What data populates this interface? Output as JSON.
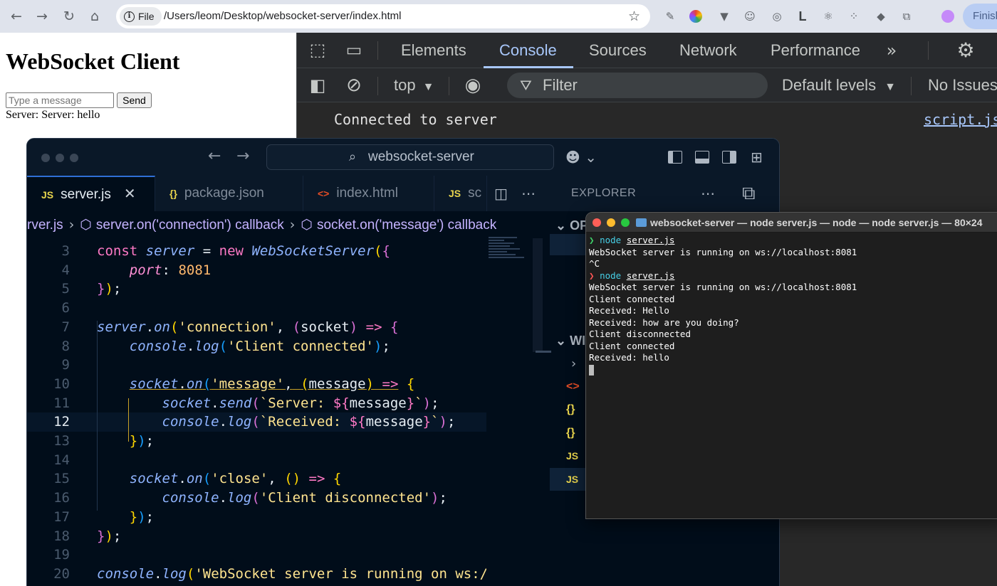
{
  "browser": {
    "file_chip": "File",
    "url": "/Users/leom/Desktop/websocket-server/index.html",
    "finish_label": "Finish"
  },
  "page": {
    "title": "WebSocket Client",
    "input_placeholder": "Type a message",
    "send_label": "Send",
    "server_message": "Server: Server: hello"
  },
  "devtools": {
    "tabs": [
      "Elements",
      "Console",
      "Sources",
      "Network",
      "Performance"
    ],
    "active_tab": "Console",
    "context": "top",
    "filter_placeholder": "Filter",
    "levels": "Default levels",
    "issues": "No Issues",
    "console_message": "Connected to server",
    "console_source": "script.js"
  },
  "vscode": {
    "command_center": "websocket-server",
    "tabs": [
      {
        "icon": "JS",
        "label": "server.js",
        "active": true,
        "icon_color": "#e8d44d"
      },
      {
        "icon": "{}",
        "label": "package.json",
        "active": false,
        "icon_color": "#e8d44d"
      },
      {
        "icon": "<>",
        "label": "index.html",
        "active": false,
        "icon_color": "#e44d26"
      },
      {
        "icon": "JS",
        "label": "sc",
        "active": false,
        "icon_color": "#e8d44d"
      }
    ],
    "breadcrumb": [
      "rver.js",
      "server.on('connection') callback",
      "socket.on('message') callback"
    ],
    "explorer_label": "EXPLORER",
    "explorer_sections": [
      "OP",
      "WI"
    ],
    "current_line": 12,
    "code_lines": [
      {
        "n": 3,
        "html": "<span style='color:#ff79c6'>const</span> <span style='color:#8fb4ff;font-style:italic'>server</span> <span style='color:#e6edf3'>=</span> <span style='color:#ff79c6'>new</span> <span style='color:#8fb4ff;font-style:italic'>WebSocketServer</span><span style='color:#ffd700'>(</span><span style='color:#da70d6'>{</span>"
      },
      {
        "n": 4,
        "html": "    <span style='color:#ff8fd6;font-style:italic'>port</span><span style='color:#e6edf3'>:</span> <span style='color:#ffb86c'>8081</span>"
      },
      {
        "n": 5,
        "html": "<span style='color:#da70d6'>}</span><span style='color:#ffd700'>)</span><span style='color:#e6edf3'>;</span>"
      },
      {
        "n": 6,
        "html": ""
      },
      {
        "n": 7,
        "html": "<span style='color:#8fb4ff;font-style:italic'>server</span><span style='color:#e6edf3'>.</span><span style='color:#8fb4ff;font-style:italic'>on</span><span style='color:#ffd700'>(</span><span style='color:#ffe48f'>'connection'</span><span style='color:#e6edf3'>,</span> <span style='color:#da70d6'>(</span><span style='color:#e6edf3'>socket</span><span style='color:#da70d6'>)</span> <span style='color:#ff79c6'>=&gt;</span> <span style='color:#da70d6'>{</span>"
      },
      {
        "n": 8,
        "html": "    <span style='color:#8fb4ff;font-style:italic'>console</span><span style='color:#e6edf3'>.</span><span style='color:#8fb4ff;font-style:italic'>log</span><span style='color:#179fff'>(</span><span style='color:#ffe48f'>'Client connected'</span><span style='color:#179fff'>)</span><span style='color:#e6edf3'>;</span>"
      },
      {
        "n": 9,
        "html": ""
      },
      {
        "n": 10,
        "html": "    <span style='color:#8fb4ff;font-style:italic;text-decoration:underline;text-decoration-color:#c9a227'>socket</span><span style='color:#e6edf3;text-decoration:underline;text-decoration-color:#c9a227'>.</span><span style='color:#8fb4ff;font-style:italic;text-decoration:underline;text-decoration-color:#c9a227'>on</span><span style='color:#179fff;text-decoration:underline;text-decoration-color:#c9a227'>(</span><span style='color:#ffe48f;text-decoration:underline;text-decoration-color:#c9a227'>'message'</span><span style='color:#e6edf3;text-decoration:underline;text-decoration-color:#c9a227'>,</span><span style='text-decoration:underline;text-decoration-color:#c9a227'> </span><span style='color:#ffd700;text-decoration:underline;text-decoration-color:#c9a227'>(</span><span style='color:#e6edf3;text-decoration:underline;text-decoration-color:#c9a227'>message</span><span style='color:#ffd700;text-decoration:underline;text-decoration-color:#c9a227'>)</span><span style='text-decoration:underline;text-decoration-color:#c9a227'> </span><span style='color:#ff79c6;text-decoration:underline;text-decoration-color:#c9a227'>=&gt;</span> <span style='color:#ffd700'>{</span>"
      },
      {
        "n": 11,
        "html": "        <span style='color:#8fb4ff;font-style:italic'>socket</span><span style='color:#e6edf3'>.</span><span style='color:#8fb4ff;font-style:italic'>send</span><span style='color:#da70d6'>(</span><span style='color:#ffe48f'>`Server: </span><span style='color:#ff79c6'>${</span><span style='color:#e6edf3'>message</span><span style='color:#ff79c6'>}</span><span style='color:#ffe48f'>`</span><span style='color:#da70d6'>)</span><span style='color:#e6edf3'>;</span>"
      },
      {
        "n": 12,
        "html": "        <span style='color:#8fb4ff;font-style:italic'>console</span><span style='color:#e6edf3'>.</span><span style='color:#8fb4ff;font-style:italic'>log</span><span style='color:#da70d6'>(</span><span style='color:#ffe48f'>`Received: </span><span style='color:#ff79c6'>${</span><span style='color:#e6edf3'>message</span><span style='color:#ff79c6'>}</span><span style='color:#ffe48f'>`</span><span style='color:#da70d6'>)</span><span style='color:#e6edf3'>;</span>"
      },
      {
        "n": 13,
        "html": "    <span style='color:#ffd700'>}</span><span style='color:#179fff'>)</span><span style='color:#e6edf3'>;</span>"
      },
      {
        "n": 14,
        "html": ""
      },
      {
        "n": 15,
        "html": "    <span style='color:#8fb4ff;font-style:italic'>socket</span><span style='color:#e6edf3'>.</span><span style='color:#8fb4ff;font-style:italic'>on</span><span style='color:#179fff'>(</span><span style='color:#ffe48f'>'close'</span><span style='color:#e6edf3'>,</span> <span style='color:#ffd700'>()</span> <span style='color:#ff79c6'>=&gt;</span> <span style='color:#ffd700'>{</span>"
      },
      {
        "n": 16,
        "html": "        <span style='color:#8fb4ff;font-style:italic'>console</span><span style='color:#e6edf3'>.</span><span style='color:#8fb4ff;font-style:italic'>log</span><span style='color:#da70d6'>(</span><span style='color:#ffe48f'>'Client disconnected'</span><span style='color:#da70d6'>)</span><span style='color:#e6edf3'>;</span>"
      },
      {
        "n": 17,
        "html": "    <span style='color:#ffd700'>}</span><span style='color:#179fff'>)</span><span style='color:#e6edf3'>;</span>"
      },
      {
        "n": 18,
        "html": "<span style='color:#da70d6'>}</span><span style='color:#ffd700'>)</span><span style='color:#e6edf3'>;</span>"
      },
      {
        "n": 19,
        "html": ""
      },
      {
        "n": 20,
        "html": "<span style='color:#8fb4ff;font-style:italic'>console</span><span style='color:#e6edf3'>.</span><span style='color:#8fb4ff;font-style:italic'>log</span><span style='color:#ffd700'>(</span><span style='color:#ffe48f'>'WebSocket server is running on ws://lo</span>"
      }
    ]
  },
  "terminal": {
    "title": "websocket-server — node server.js — node — node server.js — 80×24",
    "lines": [
      {
        "type": "cmd",
        "prompt": "❯",
        "prompt_color": "#3fd26a",
        "cmd": "node",
        "arg": "server.js"
      },
      {
        "type": "out",
        "text": "WebSocket server is running on ws://localhost:8081"
      },
      {
        "type": "out",
        "text": "^C"
      },
      {
        "type": "cmd",
        "prompt": "❯",
        "prompt_color": "#ff5555",
        "cmd": "node",
        "arg": "server.js"
      },
      {
        "type": "out",
        "text": "WebSocket server is running on ws://localhost:8081"
      },
      {
        "type": "out",
        "text": "Client connected"
      },
      {
        "type": "out",
        "text": "Received: Hello"
      },
      {
        "type": "out",
        "text": "Received: how are you doing?"
      },
      {
        "type": "out",
        "text": "Client disconnected"
      },
      {
        "type": "out",
        "text": "Client connected"
      },
      {
        "type": "out",
        "text": "Received: hello"
      },
      {
        "type": "cursor"
      }
    ]
  }
}
